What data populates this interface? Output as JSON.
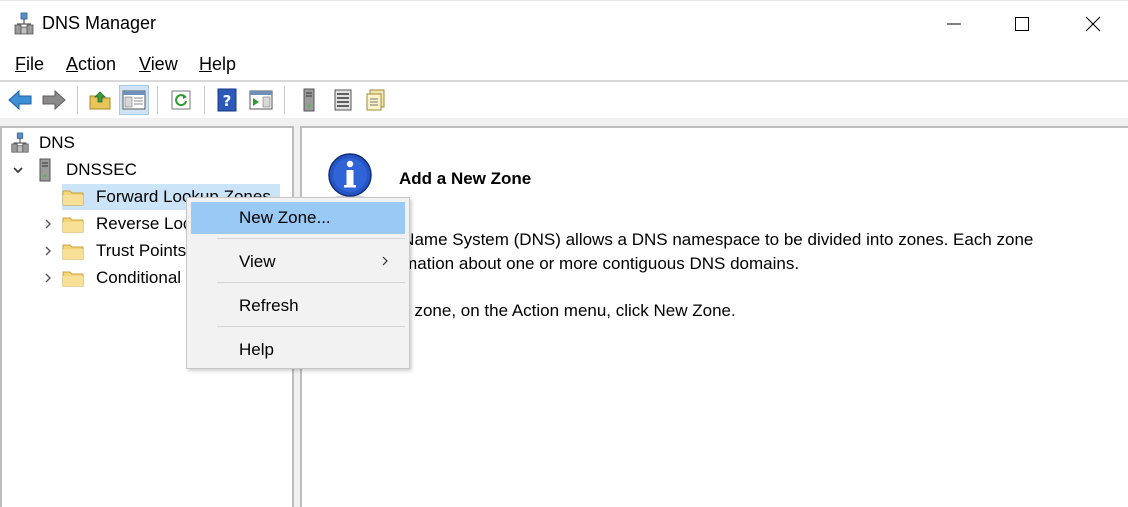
{
  "window": {
    "title": "DNS Manager"
  },
  "menu": {
    "file_u": "F",
    "file_rest": "ile",
    "action_u": "A",
    "action_rest": "ction",
    "view_u": "V",
    "view_rest": "iew",
    "help_u": "H",
    "help_rest": "elp"
  },
  "toolbar": {
    "icons": [
      "back-arrow-icon",
      "forward-arrow-icon",
      "up-folder-icon",
      "show-hide-console-tree-icon",
      "refresh-icon",
      "help-icon",
      "action-pane-icon",
      "server-icon",
      "list-icon",
      "properties-icon"
    ]
  },
  "tree": {
    "root_label": "DNS",
    "server_label": "DNSSEC",
    "items": [
      {
        "label": "Forward Lookup Zones"
      },
      {
        "label": "Reverse Loc"
      },
      {
        "label": "Trust Points"
      },
      {
        "label": "Conditional"
      }
    ]
  },
  "content": {
    "title": "Add a New Zone",
    "line1": "n Name System (DNS) allows a DNS namespace to be divided into zones. Each zone",
    "line2": "ormation about one or more contiguous DNS domains.",
    "line3": "ew zone, on the Action menu, click New Zone."
  },
  "context_menu": {
    "new_zone": "New Zone...",
    "view": "View",
    "refresh": "Refresh",
    "help": "Help"
  },
  "colors": {
    "selection": "#cce4f7",
    "menu_highlight": "#99c9f5",
    "info_blue": "#1f4fb8"
  }
}
